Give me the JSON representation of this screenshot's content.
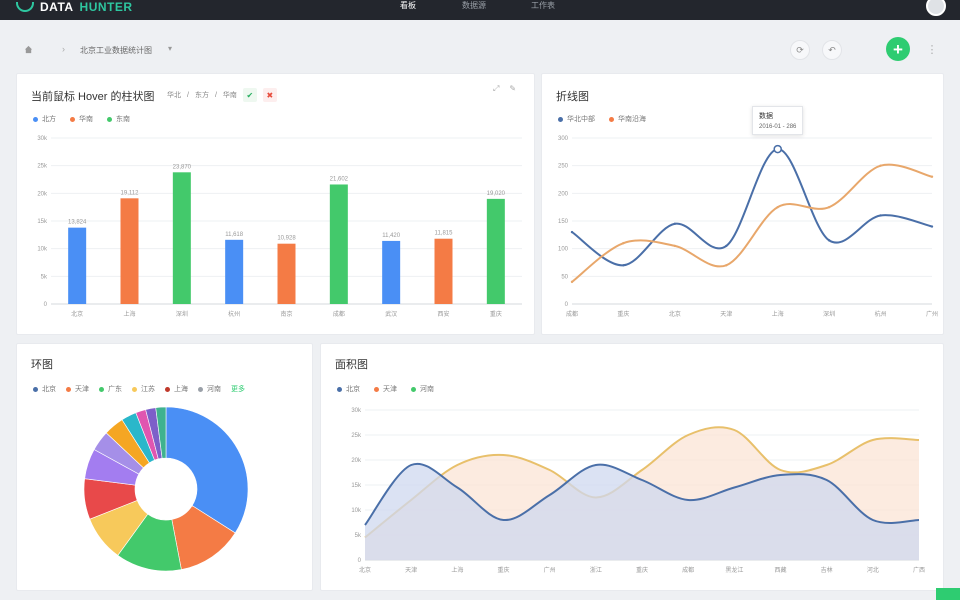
{
  "app": {
    "logo_prefix": "DATA",
    "logo_suffix": "HUNTER"
  },
  "nav": [
    {
      "label": "看板",
      "active": true
    },
    {
      "label": "数据源",
      "active": false
    },
    {
      "label": "工作表",
      "active": false
    }
  ],
  "breadcrumb": {
    "separator": "›",
    "title": "北京工业数据统计图"
  },
  "toolbar": {
    "refresh_glyph": "⟳",
    "back_glyph": "↶",
    "add_glyph": "+",
    "more_glyph": "⋮"
  },
  "colors": {
    "blue": "#4a8ff5",
    "orange": "#f47b45",
    "green": "#43c96b",
    "yellow": "#f7c95b",
    "red": "#e8494a",
    "purple": "#a37df0",
    "gray": "#9aa0a8",
    "teal": "#2ec7a0",
    "line_blue": "#4a6fa8",
    "line_orange": "#e8a76b",
    "line_yellow": "#e8c06b"
  },
  "bar_card": {
    "title": "当前鼠标 Hover 的柱状图",
    "filters": [
      "华北",
      "/",
      "东方",
      "/",
      "华南"
    ],
    "check_glyph": "✔",
    "close_glyph": "✖",
    "expand_glyph": "⤢",
    "edit_glyph": "✎",
    "legend": [
      {
        "label": "北方",
        "color": "#4a8ff5"
      },
      {
        "label": "华南",
        "color": "#f47b45"
      },
      {
        "label": "东南",
        "color": "#43c96b"
      }
    ]
  },
  "line_card": {
    "title": "折线图",
    "legend": [
      {
        "label": "华北中部",
        "color": "#4a6fa8"
      },
      {
        "label": "华南沿海",
        "color": "#f47b45"
      }
    ],
    "tooltip": {
      "title": "数据",
      "value": "2016-01 - 286"
    }
  },
  "ring_card": {
    "title": "环图",
    "legend": [
      {
        "label": "北京",
        "color": "#4a6fa8"
      },
      {
        "label": "天津",
        "color": "#f47b45"
      },
      {
        "label": "广东",
        "color": "#43c96b"
      },
      {
        "label": "江苏",
        "color": "#f7c95b"
      },
      {
        "label": "上海",
        "color": "#c0392b"
      },
      {
        "label": "河南",
        "color": "#9aa0a8"
      }
    ],
    "legend_more": "更多"
  },
  "area_card": {
    "title": "面积图",
    "legend": [
      {
        "label": "北京",
        "color": "#4a6fa8"
      },
      {
        "label": "天津",
        "color": "#f47b45"
      },
      {
        "label": "河南",
        "color": "#43c96b"
      }
    ]
  },
  "chart_data": [
    {
      "type": "bar",
      "categories": [
        "北京",
        "上海",
        "深圳",
        "杭州",
        "南京",
        "成都",
        "武汉",
        "西安",
        "重庆"
      ],
      "yticks": [
        "0",
        "5k",
        "10k",
        "15k",
        "20k",
        "25k",
        "30k"
      ],
      "ylim": [
        0,
        30000
      ],
      "values": [
        13800,
        19100,
        23800,
        11600,
        10900,
        21600,
        11400,
        11800,
        19000
      ],
      "value_labels": [
        "13,824",
        "19,112",
        "23,870",
        "11,618",
        "10,928",
        "21,602",
        "11,420",
        "11,815",
        "19,020"
      ],
      "bar_colors": [
        "#4a8ff5",
        "#f47b45",
        "#43c96b",
        "#4a8ff5",
        "#f47b45",
        "#43c96b",
        "#4a8ff5",
        "#f47b45",
        "#43c96b"
      ],
      "grid": true
    },
    {
      "type": "line",
      "categories": [
        "成都",
        "重庆",
        "北京",
        "天津",
        "上海",
        "深圳",
        "杭州",
        "广州"
      ],
      "yticks": [
        "0",
        "50",
        "100",
        "150",
        "200",
        "250",
        "300"
      ],
      "ylim": [
        0,
        300
      ],
      "series": [
        {
          "name": "华北中部",
          "color": "#4a6fa8",
          "values": [
            130,
            70,
            145,
            105,
            280,
            115,
            160,
            140
          ]
        },
        {
          "name": "华南沿海",
          "color": "#e8a76b",
          "values": [
            40,
            110,
            105,
            70,
            175,
            175,
            250,
            230
          ]
        }
      ],
      "grid": true
    },
    {
      "type": "pie",
      "donut": true,
      "values": [
        34,
        13,
        13,
        9,
        8,
        6,
        4,
        4,
        3,
        2,
        2,
        2
      ],
      "colors": [
        "#4a8ff5",
        "#f47b45",
        "#43c96b",
        "#f7c95b",
        "#e8494a",
        "#a37df0",
        "#a58fe8",
        "#f5a623",
        "#2ab7ca",
        "#e056b0",
        "#7d5fc9",
        "#3fb28f"
      ]
    },
    {
      "type": "area",
      "categories": [
        "北京",
        "天津",
        "上海",
        "重庆",
        "广州",
        "浙江",
        "重庆",
        "成都",
        "黑龙江",
        "西藏",
        "吉林",
        "河北",
        "广西"
      ],
      "yticks": [
        "0",
        "5k",
        "10k",
        "15k",
        "20k",
        "25k",
        "30k"
      ],
      "ylim": [
        0,
        30000
      ],
      "series": [
        {
          "name": "北京",
          "color": "#4a6fa8",
          "fill": "#cfd8ef",
          "values": [
            7000,
            19000,
            14500,
            8000,
            13000,
            19000,
            16000,
            12000,
            14500,
            17000,
            16000,
            8000,
            8000
          ]
        },
        {
          "name": "天津",
          "color": "#e8c06b",
          "fill": "#fbe4d6",
          "values": [
            4500,
            12000,
            19000,
            21000,
            18000,
            12500,
            18000,
            25000,
            26000,
            18000,
            19000,
            24000,
            24000
          ]
        }
      ],
      "grid": true
    }
  ]
}
